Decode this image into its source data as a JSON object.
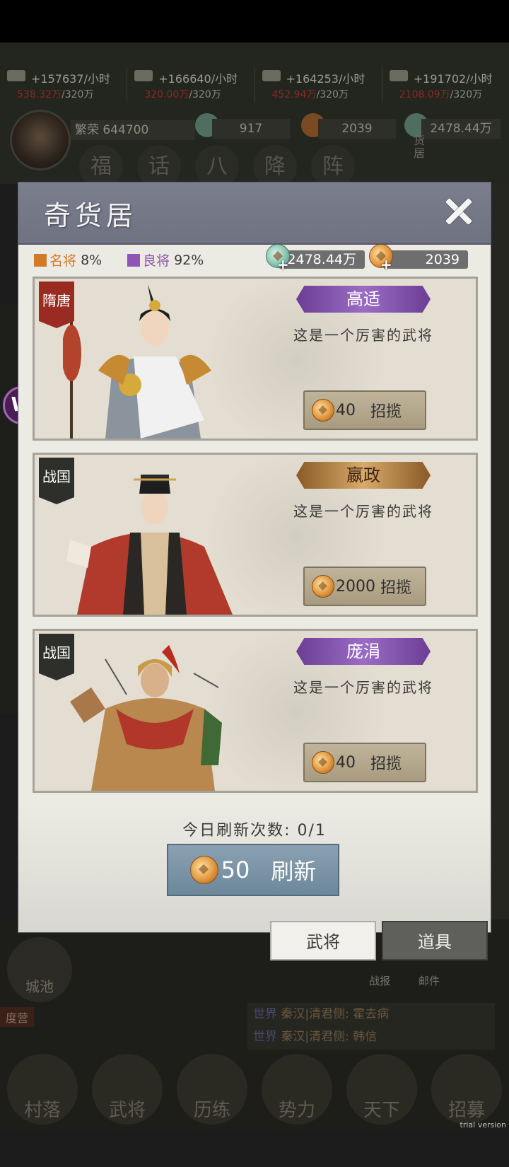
{
  "background": {
    "resources": [
      {
        "rate": "+157637/小时",
        "cap_current": "538.32万",
        "cap_max": "/320万"
      },
      {
        "rate": "+166640/小时",
        "cap_current": "320.00万",
        "cap_max": "/320万"
      },
      {
        "rate": "+164253/小时",
        "cap_current": "452.94万",
        "cap_max": "/320万"
      },
      {
        "rate": "+191702/小时",
        "cap_current": "2108.09万",
        "cap_max": "/320万"
      }
    ],
    "prosperity": "繁荣 644700",
    "currencies": [
      "917",
      "2039",
      "2478.44万"
    ],
    "circles": [
      "福",
      "话",
      "八",
      "降",
      "阵"
    ],
    "side_label": "货居",
    "city_label": "城池",
    "camp_label": "度营",
    "small_links": [
      "战报",
      "邮件"
    ],
    "chat": [
      {
        "channel": "世界",
        "text": "秦汉|清君侧: 霍去病"
      },
      {
        "channel": "世界",
        "text": "秦汉|清君侧: 韩信"
      }
    ],
    "bottom_nav": [
      "村落",
      "武将",
      "历练",
      "势力",
      "天下",
      "招募"
    ],
    "trial_label": "trial version"
  },
  "dialog": {
    "title": "奇货居",
    "rates": [
      {
        "label": "名将",
        "value": "8%",
        "color": "#d37a2a"
      },
      {
        "label": "良将",
        "value": "92%",
        "color": "#8d55b5"
      }
    ],
    "jade_amount": "2478.44万",
    "gold_amount": "2039",
    "generals": [
      {
        "era": "隋唐",
        "name": "高适",
        "desc": "这是一个厉害的武将",
        "price": "40",
        "action": "招揽"
      },
      {
        "era": "战国",
        "name": "嬴政",
        "desc": "这是一个厉害的武将",
        "price": "2000",
        "action": "招揽"
      },
      {
        "era": "战国",
        "name": "庞涓",
        "desc": "这是一个厉害的武将",
        "price": "40",
        "action": "招揽"
      }
    ],
    "refresh_count_label": "今日刷新次数: 0/1",
    "refresh_cost": "50",
    "refresh_action": "刷新"
  },
  "tabs": {
    "generals": "武将",
    "items": "道具"
  }
}
